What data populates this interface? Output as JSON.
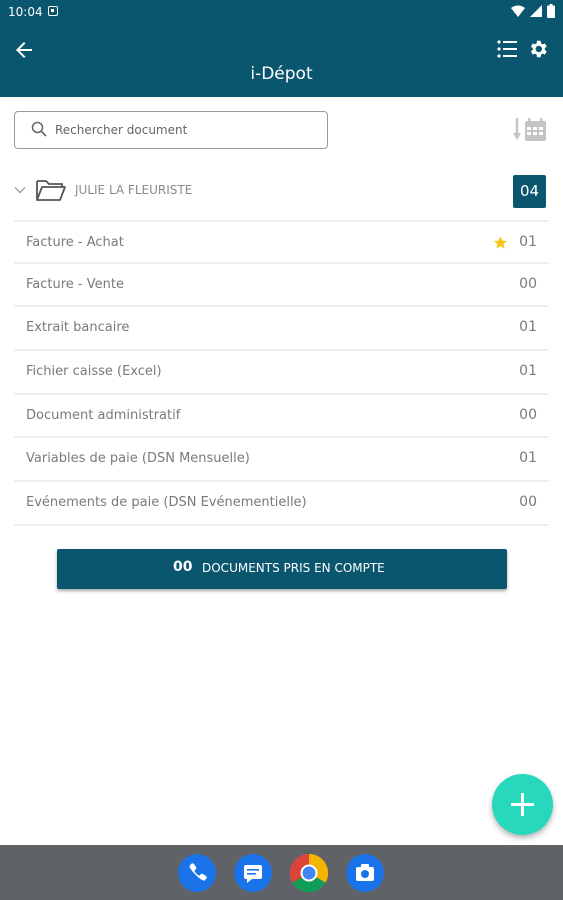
{
  "status_bar": {
    "time": "10:04"
  },
  "app_bar": {
    "title": "i-Dépot"
  },
  "search": {
    "placeholder": "Rechercher document"
  },
  "folder": {
    "name": "JULIE LA FLEURISTE",
    "count": "04"
  },
  "documents": [
    {
      "label": "Facture - Achat",
      "count": "01",
      "starred": true
    },
    {
      "label": "Facture - Vente",
      "count": "00",
      "starred": false
    },
    {
      "label": "Extrait bancaire",
      "count": "01",
      "starred": false
    },
    {
      "label": "Fichier caisse (Excel)",
      "count": "01",
      "starred": false
    },
    {
      "label": "Document administratif",
      "count": "00",
      "starred": false
    },
    {
      "label": "Variables de paie (DSN Mensuelle)",
      "count": "01",
      "starred": false
    },
    {
      "label": "Evénements de paie (DSN Evénementielle)",
      "count": "00",
      "starred": false
    }
  ],
  "summary_button": {
    "count": "00",
    "label": "DOCUMENTS PRIS EN COMPTE"
  },
  "colors": {
    "primary": "#0b566f",
    "fab": "#28d8bd",
    "star": "#f5c518"
  },
  "dock_apps": [
    "phone-icon",
    "messages-icon",
    "chrome-icon",
    "camera-icon"
  ]
}
